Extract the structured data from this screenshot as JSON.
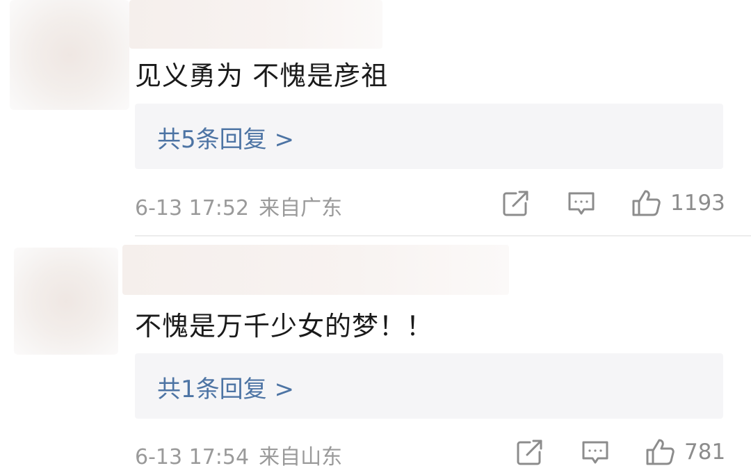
{
  "comments": [
    {
      "text": "见义勇为 不愧是彦祖",
      "reply_label": "共5条回复 >",
      "time": "6-13 17:52",
      "location": "来自广东",
      "likes": "1193",
      "icons": {
        "share": "share-icon",
        "comment": "comment-icon",
        "like": "thumbs-up-icon"
      }
    },
    {
      "text": "不愧是万千少女的梦！！",
      "reply_label": "共1条回复 >",
      "time": "6-13 17:54",
      "location": "来自山东",
      "likes": "781",
      "icons": {
        "share": "share-icon",
        "comment": "comment-icon",
        "like": "thumbs-up-icon"
      }
    }
  ],
  "colors": {
    "reply_link": "#4d74a4",
    "reply_bg": "#f5f5f7",
    "meta": "#9a9a9a",
    "icon": "#8c8c8c"
  }
}
